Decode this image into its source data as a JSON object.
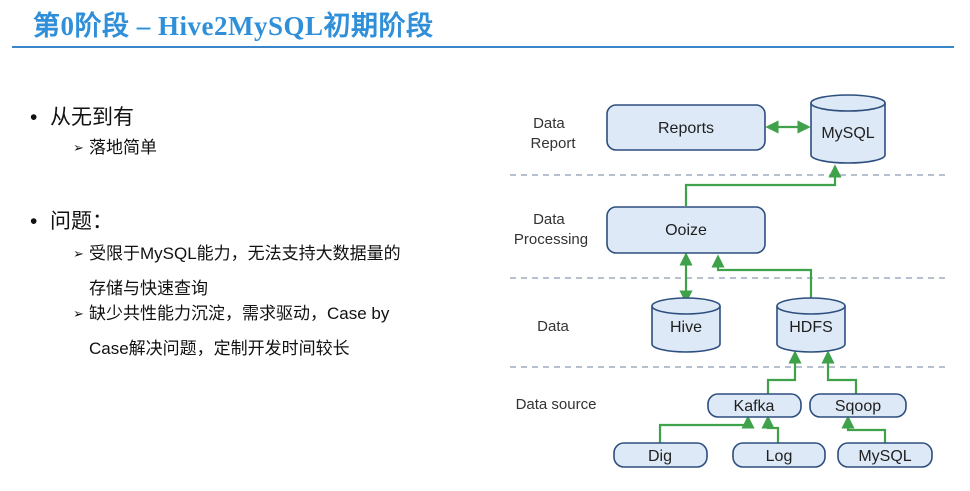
{
  "slide": {
    "title": "第0阶段 – Hive2MySQL初期阶段",
    "bullets": [
      {
        "text": "从无到有",
        "subs": [
          {
            "lines": [
              "落地简单"
            ]
          }
        ]
      },
      {
        "text": "问题：",
        "subs": [
          {
            "lines": [
              "受限于MySQL能力，无法支持大数据量的",
              "存储与快速查询"
            ]
          },
          {
            "lines": [
              "缺少共性能力沉淀，需求驱动，Case by",
              "Case解决问题，定制开发时间较长"
            ]
          }
        ]
      }
    ]
  },
  "diagram": {
    "layers": {
      "report": [
        "Data",
        "Report"
      ],
      "processing": [
        "Data",
        "Processing"
      ],
      "data": [
        "Data"
      ],
      "source": [
        "Data source"
      ]
    },
    "nodes": {
      "reports": "Reports",
      "mysql_top": "MySQL",
      "ooize": "Ooize",
      "hive": "Hive",
      "hdfs": "HDFS",
      "kafka": "Kafka",
      "sqoop": "Sqoop",
      "dig": "Dig",
      "log": "Log",
      "mysql_src": "MySQL"
    },
    "colors": {
      "node_fill": "#dde9f7",
      "node_stroke": "#2d4e7e",
      "arrow": "#3fa24a",
      "separator": "#8a9bb0"
    }
  }
}
